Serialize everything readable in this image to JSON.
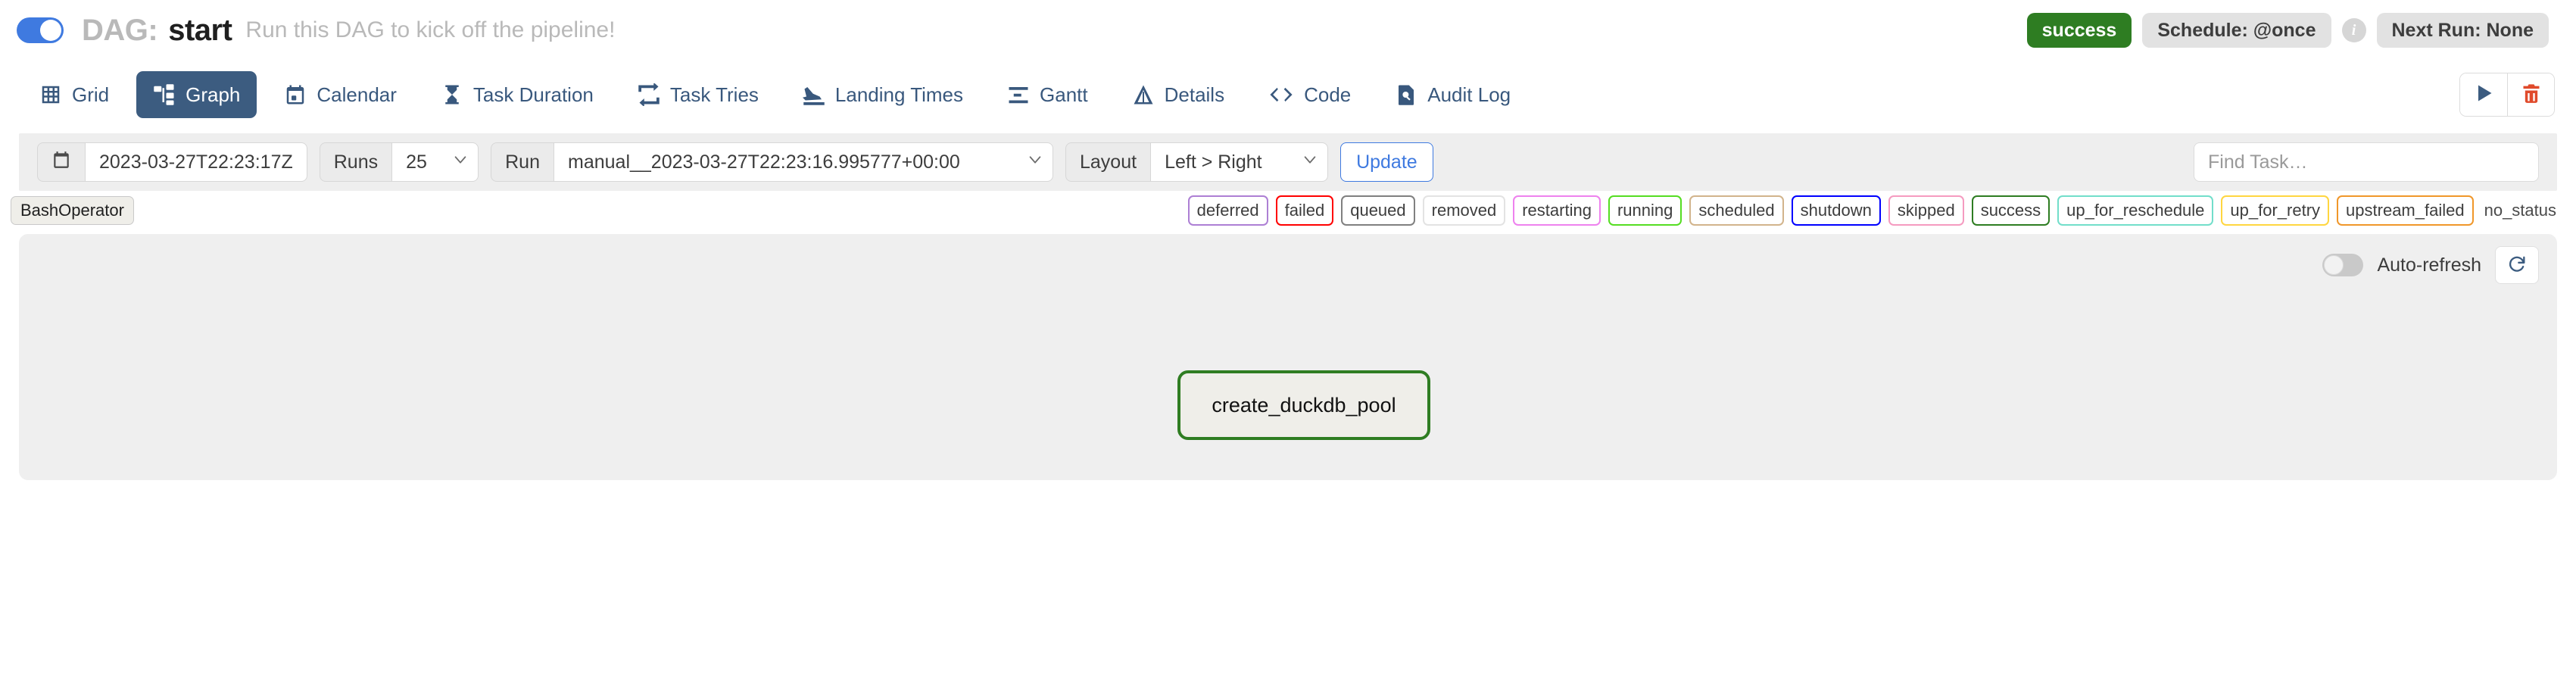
{
  "header": {
    "dag_toggle_on": true,
    "dag_prefix": "DAG:",
    "dag_name": "start",
    "dag_description": "Run this DAG to kick off the pipeline!",
    "status_badge": "success",
    "schedule_badge": "Schedule: @once",
    "info_icon_char": "i",
    "next_run_badge": "Next Run: None"
  },
  "tabs": [
    {
      "label": "Grid",
      "icon": "grid-icon",
      "active": false
    },
    {
      "label": "Graph",
      "icon": "graph-icon",
      "active": true
    },
    {
      "label": "Calendar",
      "icon": "calendar-icon",
      "active": false
    },
    {
      "label": "Task Duration",
      "icon": "hourglass-icon",
      "active": false
    },
    {
      "label": "Task Tries",
      "icon": "retry-icon",
      "active": false
    },
    {
      "label": "Landing Times",
      "icon": "landing-icon",
      "active": false
    },
    {
      "label": "Gantt",
      "icon": "gantt-icon",
      "active": false
    },
    {
      "label": "Details",
      "icon": "triangle-icon",
      "active": false
    },
    {
      "label": "Code",
      "icon": "code-icon",
      "active": false
    },
    {
      "label": "Audit Log",
      "icon": "audit-log-icon",
      "active": false
    }
  ],
  "tab_actions": {
    "trigger_icon": "play-icon",
    "delete_icon": "trash-icon"
  },
  "filterbar": {
    "calendar_icon": "calendar-icon",
    "date_value": "2023-03-27T22:23:17Z",
    "runs_label": "Runs",
    "runs_value": "25",
    "run_label": "Run",
    "run_value": "manual__2023-03-27T22:23:16.995777+00:00",
    "layout_label": "Layout",
    "layout_value": "Left > Right",
    "update_label": "Update",
    "find_task_placeholder": "Find Task…",
    "find_task_value": ""
  },
  "legend": {
    "operator_badge": "BashOperator",
    "items": [
      {
        "label": "deferred",
        "color": "#ad7fd4"
      },
      {
        "label": "failed",
        "color": "#ff0000"
      },
      {
        "label": "queued",
        "color": "#808080"
      },
      {
        "label": "removed",
        "color": "#e3e3e3"
      },
      {
        "label": "restarting",
        "color": "#ee82ee"
      },
      {
        "label": "running",
        "color": "#55dd22"
      },
      {
        "label": "scheduled",
        "color": "#d2b48c"
      },
      {
        "label": "shutdown",
        "color": "#0000ff"
      },
      {
        "label": "skipped",
        "color": "#f59bc0"
      },
      {
        "label": "success",
        "color": "#2e7d22"
      },
      {
        "label": "up_for_reschedule",
        "color": "#72deca"
      },
      {
        "label": "up_for_retry",
        "color": "#ffd640"
      },
      {
        "label": "upstream_failed",
        "color": "#f0972a"
      },
      {
        "label": "no_status",
        "color": "none"
      }
    ]
  },
  "canvas": {
    "auto_refresh_label": "Auto-refresh",
    "auto_refresh_on": false,
    "refresh_icon": "refresh-icon",
    "nodes": [
      {
        "label": "create_duckdb_pool",
        "status": "success",
        "border_color": "#2f7d22"
      }
    ]
  }
}
